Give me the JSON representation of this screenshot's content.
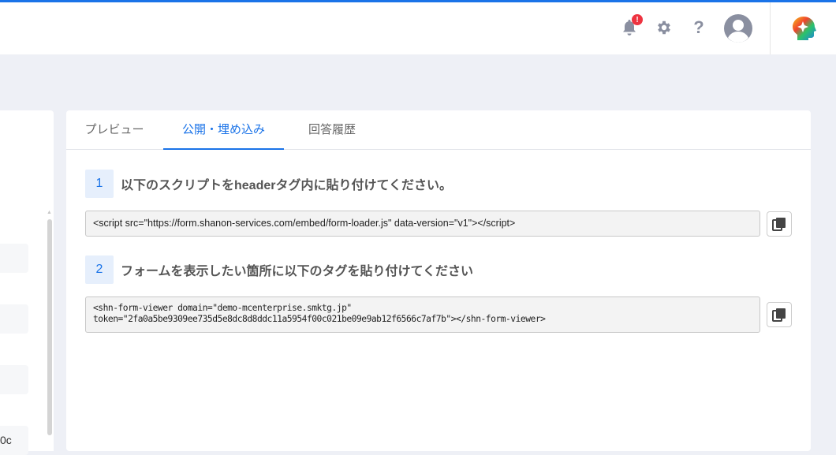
{
  "header": {
    "notification_badge": "!",
    "help": "?"
  },
  "left_panel": {
    "partial_text": "0c"
  },
  "tabs": [
    {
      "label": "プレビュー"
    },
    {
      "label": "公開・埋め込み",
      "active": true
    },
    {
      "label": "回答履歴"
    }
  ],
  "steps": [
    {
      "number": "1",
      "title": "以下のスクリプトをheaderタグ内に貼り付けてください。",
      "code": "<script src=\"https://form.shanon-services.com/embed/form-loader.js\" data-version=\"v1\"></script>"
    },
    {
      "number": "2",
      "title": "フォームを表示したい箇所に以下のタグを貼り付けてください",
      "code": "<shn-form-viewer domain=\"demo-mcenterprise.smktg.jp\"\ntoken=\"2fa0a5be9309ee735d5e8dc8d8ddc11a5954f00c021be09e9ab12f6566c7af7b\"></shn-form-viewer>"
    }
  ],
  "colors": {
    "accent": "#1a73e8",
    "badge": "#ee3340"
  }
}
